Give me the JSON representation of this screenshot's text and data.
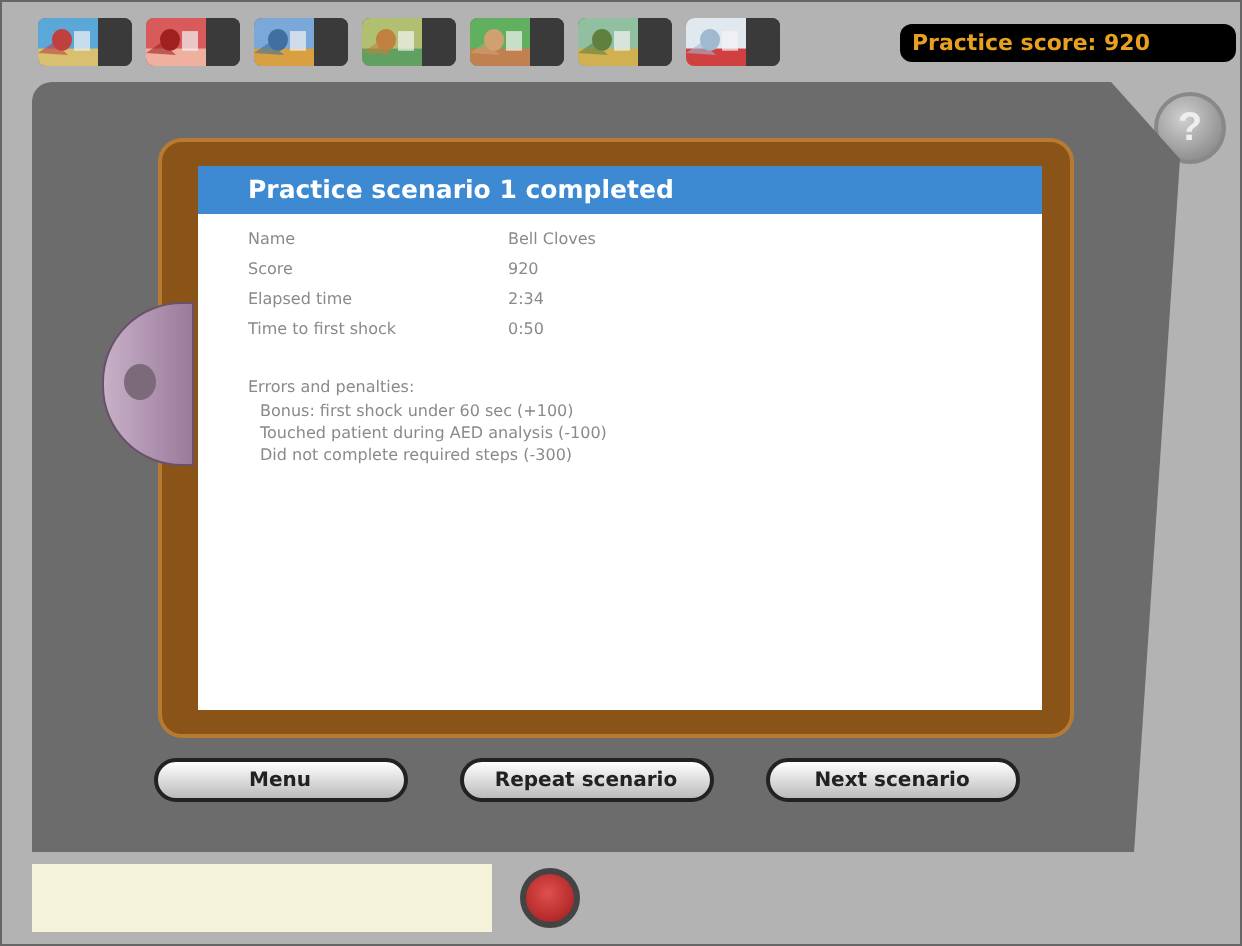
{
  "toolbar": {
    "score": "Practice score: 920",
    "help": "?"
  },
  "dialog": {
    "title": "Practice scenario 1 completed",
    "fields": [
      {
        "label": "Name",
        "value": "Bell Cloves"
      },
      {
        "label": "Score",
        "value": "920"
      },
      {
        "label": "Elapsed time",
        "value": "2:34"
      },
      {
        "label": "Time to first shock",
        "value": "0:50"
      }
    ],
    "errors_heading": "Errors and penalties:",
    "errors": [
      "Bonus: first shock under 60 sec (+100)",
      "Touched patient during AED analysis (-100)",
      "Did not complete required steps (-300)"
    ]
  },
  "buttons": [
    "Menu",
    "Repeat scenario",
    "Next scenario"
  ]
}
